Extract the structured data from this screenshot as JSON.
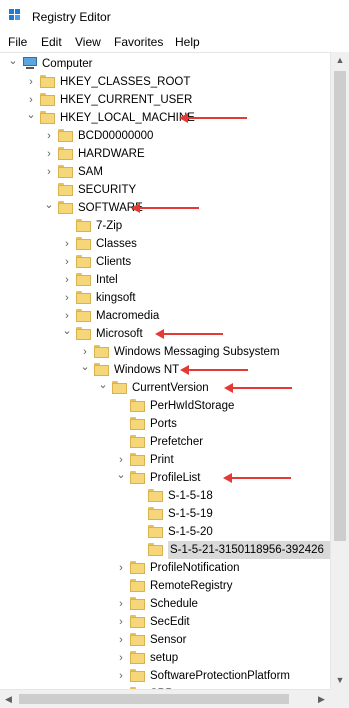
{
  "window": {
    "title": "Registry Editor"
  },
  "menu": [
    "File",
    "Edit",
    "View",
    "Favorites",
    "Help"
  ],
  "tree": [
    {
      "label": "Computer",
      "depth": 0,
      "chevron": "expanded",
      "icon": "computer-icon"
    },
    {
      "label": "HKEY_CLASSES_ROOT",
      "depth": 1,
      "chevron": "collapsed",
      "icon": "folder-icon"
    },
    {
      "label": "HKEY_CURRENT_USER",
      "depth": 1,
      "chevron": "collapsed",
      "icon": "folder-icon"
    },
    {
      "label": "HKEY_LOCAL_MACHINE",
      "depth": 1,
      "chevron": "expanded",
      "icon": "folder-icon",
      "arrow": true
    },
    {
      "label": "BCD00000000",
      "depth": 2,
      "chevron": "collapsed",
      "icon": "folder-icon"
    },
    {
      "label": "HARDWARE",
      "depth": 2,
      "chevron": "collapsed",
      "icon": "folder-icon"
    },
    {
      "label": "SAM",
      "depth": 2,
      "chevron": "collapsed",
      "icon": "folder-icon"
    },
    {
      "label": "SECURITY",
      "depth": 2,
      "chevron": "none",
      "icon": "folder-icon"
    },
    {
      "label": "SOFTWARE",
      "depth": 2,
      "chevron": "expanded",
      "icon": "folder-icon",
      "arrow": true
    },
    {
      "label": "7-Zip",
      "depth": 3,
      "chevron": "none",
      "icon": "folder-icon"
    },
    {
      "label": "Classes",
      "depth": 3,
      "chevron": "collapsed",
      "icon": "folder-icon"
    },
    {
      "label": "Clients",
      "depth": 3,
      "chevron": "collapsed",
      "icon": "folder-icon"
    },
    {
      "label": "Intel",
      "depth": 3,
      "chevron": "collapsed",
      "icon": "folder-icon"
    },
    {
      "label": "kingsoft",
      "depth": 3,
      "chevron": "collapsed",
      "icon": "folder-icon"
    },
    {
      "label": "Macromedia",
      "depth": 3,
      "chevron": "collapsed",
      "icon": "folder-icon"
    },
    {
      "label": "Microsoft",
      "depth": 3,
      "chevron": "expanded",
      "icon": "folder-icon",
      "arrow": true
    },
    {
      "label": "Windows Messaging Subsystem",
      "depth": 4,
      "chevron": "collapsed",
      "icon": "folder-icon"
    },
    {
      "label": "Windows NT",
      "depth": 4,
      "chevron": "expanded",
      "icon": "folder-icon",
      "arrow": true
    },
    {
      "label": "CurrentVersion",
      "depth": 5,
      "chevron": "expanded",
      "icon": "folder-icon",
      "arrow": true
    },
    {
      "label": "PerHwIdStorage",
      "depth": 6,
      "chevron": "none",
      "icon": "folder-icon"
    },
    {
      "label": "Ports",
      "depth": 6,
      "chevron": "none",
      "icon": "folder-icon"
    },
    {
      "label": "Prefetcher",
      "depth": 6,
      "chevron": "none",
      "icon": "folder-icon"
    },
    {
      "label": "Print",
      "depth": 6,
      "chevron": "collapsed",
      "icon": "folder-icon"
    },
    {
      "label": "ProfileList",
      "depth": 6,
      "chevron": "expanded",
      "icon": "folder-icon",
      "arrow": true
    },
    {
      "label": "S-1-5-18",
      "depth": 7,
      "chevron": "none",
      "icon": "folder-icon"
    },
    {
      "label": "S-1-5-19",
      "depth": 7,
      "chevron": "none",
      "icon": "folder-icon"
    },
    {
      "label": "S-1-5-20",
      "depth": 7,
      "chevron": "none",
      "icon": "folder-icon"
    },
    {
      "label": "S-1-5-21-3150118956-392426",
      "depth": 7,
      "chevron": "none",
      "icon": "folder-icon",
      "selected": true
    },
    {
      "label": "ProfileNotification",
      "depth": 6,
      "chevron": "collapsed",
      "icon": "folder-icon"
    },
    {
      "label": "RemoteRegistry",
      "depth": 6,
      "chevron": "none",
      "icon": "folder-icon"
    },
    {
      "label": "Schedule",
      "depth": 6,
      "chevron": "collapsed",
      "icon": "folder-icon"
    },
    {
      "label": "SecEdit",
      "depth": 6,
      "chevron": "collapsed",
      "icon": "folder-icon"
    },
    {
      "label": "Sensor",
      "depth": 6,
      "chevron": "collapsed",
      "icon": "folder-icon"
    },
    {
      "label": "setup",
      "depth": 6,
      "chevron": "collapsed",
      "icon": "folder-icon"
    },
    {
      "label": "SoftwareProtectionPlatform",
      "depth": 6,
      "chevron": "collapsed",
      "icon": "folder-icon"
    },
    {
      "label": "SPP",
      "depth": 6,
      "chevron": "collapsed",
      "icon": "folder-icon"
    }
  ],
  "colors": {
    "arrow": "#e53935",
    "selection": "#d9d9d9",
    "folder": "#f5d77a"
  }
}
